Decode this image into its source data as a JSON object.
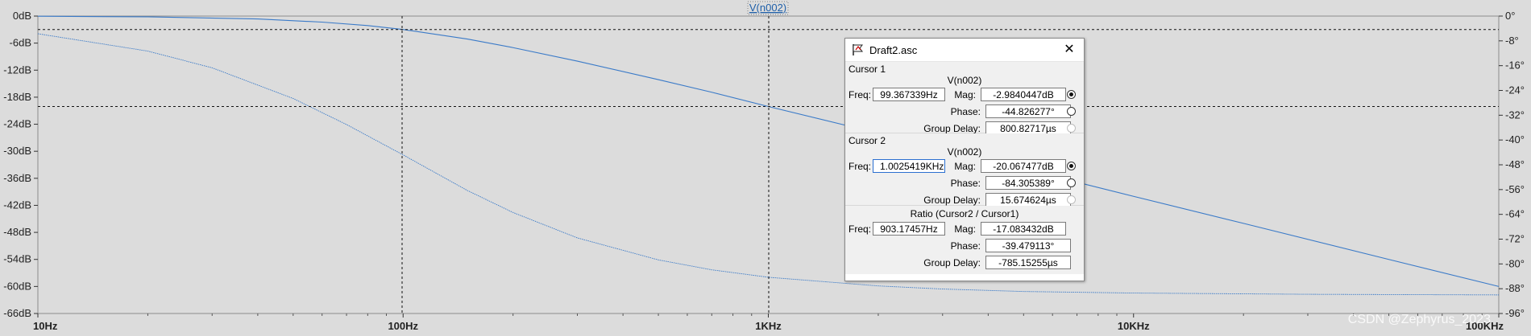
{
  "chart_data": {
    "type": "line",
    "xscale": "log",
    "xlim": [
      10,
      100000
    ],
    "ylim_left": [
      -66,
      0
    ],
    "ylim_right": [
      -96,
      0
    ],
    "x_tick_labels": [
      "10Hz",
      "100Hz",
      "1KHz",
      "10KHz",
      "100KHz"
    ],
    "y_left_tick_labels": [
      "0dB",
      "-6dB",
      "-12dB",
      "-18dB",
      "-24dB",
      "-30dB",
      "-36dB",
      "-42dB",
      "-48dB",
      "-54dB",
      "-60dB",
      "-66dB"
    ],
    "y_right_tick_labels": [
      "0°",
      "-8°",
      "-16°",
      "-24°",
      "-32°",
      "-40°",
      "-48°",
      "-56°",
      "-64°",
      "-72°",
      "-80°",
      "-88°",
      "-96°"
    ],
    "series": [
      {
        "name": "V(n002)",
        "axis": "left",
        "points": [
          [
            10,
            -0.04
          ],
          [
            20,
            -0.17
          ],
          [
            40,
            -0.64
          ],
          [
            60,
            -1.34
          ],
          [
            80,
            -2.1
          ],
          [
            100,
            -2.98
          ],
          [
            150,
            -5.1
          ],
          [
            200,
            -7.0
          ],
          [
            300,
            -10.0
          ],
          [
            500,
            -14.1
          ],
          [
            700,
            -16.9
          ],
          [
            1000,
            -20.07
          ],
          [
            2000,
            -26.0
          ],
          [
            3000,
            -29.5
          ],
          [
            5000,
            -33.9
          ],
          [
            10000,
            -40.0
          ],
          [
            20000,
            -46.0
          ],
          [
            50000,
            -54.0
          ],
          [
            100000,
            -60.0
          ]
        ]
      },
      {
        "name": "phase",
        "axis": "right",
        "points": [
          [
            10,
            -5.7
          ],
          [
            20,
            -11.3
          ],
          [
            30,
            -16.7
          ],
          [
            50,
            -26.6
          ],
          [
            70,
            -35.0
          ],
          [
            100,
            -44.8
          ],
          [
            150,
            -56.3
          ],
          [
            200,
            -63.4
          ],
          [
            300,
            -71.6
          ],
          [
            500,
            -78.7
          ],
          [
            700,
            -81.9
          ],
          [
            1000,
            -84.3
          ],
          [
            2000,
            -87.1
          ],
          [
            3000,
            -88.1
          ],
          [
            5000,
            -88.9
          ],
          [
            10000,
            -89.4
          ],
          [
            30000,
            -89.8
          ],
          [
            100000,
            -90.0
          ]
        ]
      }
    ],
    "cursors": [
      {
        "x": 99.367339,
        "y": -2.9840447
      },
      {
        "x": 1002.5419,
        "y": -20.067477
      }
    ]
  },
  "colors": {
    "background": "#dcdcdc",
    "trace": "#3a7ac8",
    "grid": "#b4b4b4"
  },
  "trace_label": "V(n002)",
  "watermark": "CSDN @Zephyrus_2023",
  "dialog": {
    "title": "Draft2.asc",
    "close": "✕",
    "cursor1": {
      "title": "Cursor 1",
      "signal": "V(n002)",
      "freq_label": "Freq:",
      "freq": "99.367339Hz",
      "mag_label": "Mag:",
      "mag": "-2.9840447dB",
      "phase_label": "Phase:",
      "phase": "-44.826277°",
      "gd_label": "Group Delay:",
      "gd": "800.82717µs"
    },
    "cursor2": {
      "title": "Cursor 2",
      "signal": "V(n002)",
      "freq_label": "Freq:",
      "freq": "1.0025419KHz",
      "mag_label": "Mag:",
      "mag": "-20.067477dB",
      "phase_label": "Phase:",
      "phase": "-84.305389°",
      "gd_label": "Group Delay:",
      "gd": "15.674624µs"
    },
    "ratio": {
      "title": "Ratio (Cursor2 / Cursor1)",
      "freq_label": "Freq:",
      "freq": "903.17457Hz",
      "mag_label": "Mag:",
      "mag": "-17.083432dB",
      "phase_label": "Phase:",
      "phase": "-39.479113°",
      "gd_label": "Group Delay:",
      "gd": "-785.15255µs"
    }
  }
}
